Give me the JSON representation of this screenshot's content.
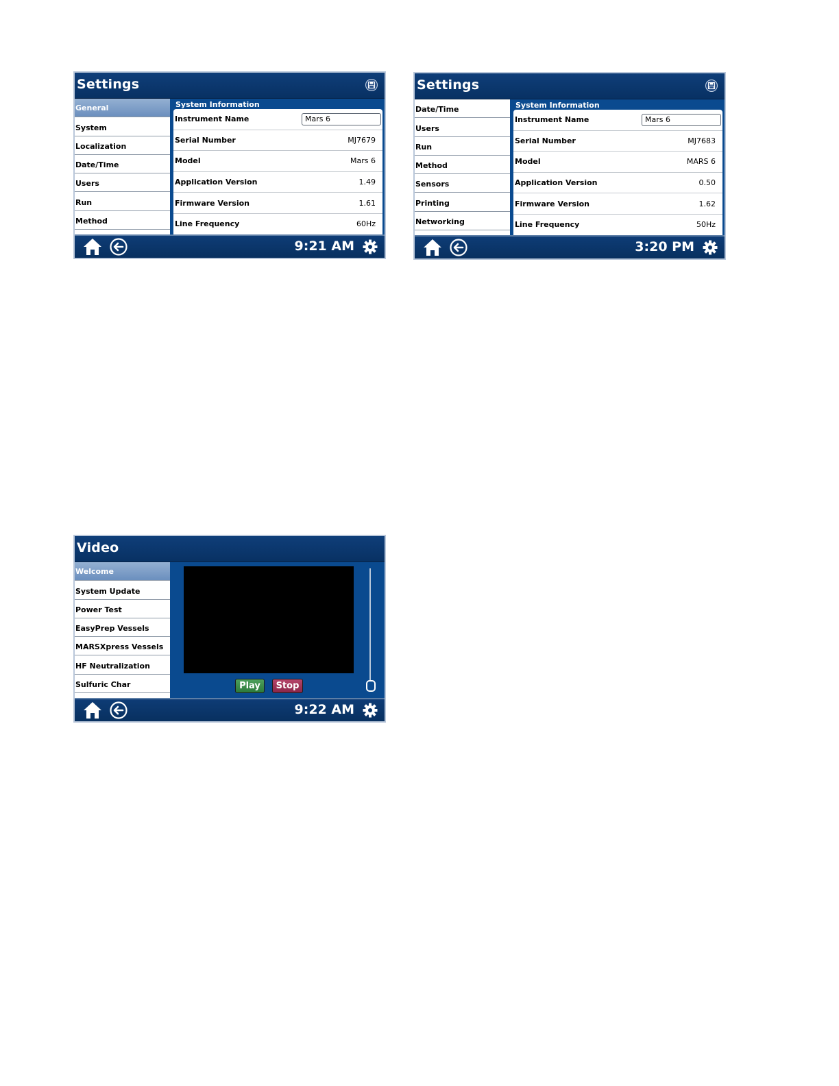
{
  "screens": [
    {
      "title": "Settings",
      "time": "9:21 AM",
      "sidebar": [
        {
          "label": "General",
          "selected": true
        },
        {
          "label": "System",
          "selected": false
        },
        {
          "label": "Localization",
          "selected": false
        },
        {
          "label": "Date/Time",
          "selected": false
        },
        {
          "label": "Users",
          "selected": false
        },
        {
          "label": "Run",
          "selected": false
        },
        {
          "label": "Method",
          "selected": false
        }
      ],
      "section": "System Information",
      "rows": [
        {
          "label": "Instrument Name",
          "value": "Mars 6",
          "editable": true
        },
        {
          "label": "Serial Number",
          "value": "MJ7679"
        },
        {
          "label": "Model",
          "value": "Mars 6"
        },
        {
          "label": "Application Version",
          "value": "1.49"
        },
        {
          "label": "Firmware Version",
          "value": "1.61"
        },
        {
          "label": "Line Frequency",
          "value": "60Hz"
        }
      ]
    },
    {
      "title": "Settings",
      "time": "3:20 PM",
      "sidebar": [
        {
          "label": "Date/Time",
          "selected": false
        },
        {
          "label": "Users",
          "selected": false
        },
        {
          "label": "Run",
          "selected": false
        },
        {
          "label": "Method",
          "selected": false
        },
        {
          "label": "Sensors",
          "selected": false
        },
        {
          "label": "Printing",
          "selected": false
        },
        {
          "label": "Networking",
          "selected": false
        }
      ],
      "section": "System Information",
      "rows": [
        {
          "label": "Instrument Name",
          "value": "Mars 6",
          "editable": true
        },
        {
          "label": "Serial Number",
          "value": "MJ7683"
        },
        {
          "label": "Model",
          "value": "MARS 6"
        },
        {
          "label": "Application Version",
          "value": "0.50"
        },
        {
          "label": "Firmware Version",
          "value": "1.62"
        },
        {
          "label": "Line Frequency",
          "value": "50Hz"
        }
      ]
    },
    {
      "title": "Video",
      "time": "9:22 AM",
      "sidebar": [
        {
          "label": "Welcome",
          "selected": true
        },
        {
          "label": "System Update",
          "selected": false
        },
        {
          "label": "Power Test",
          "selected": false
        },
        {
          "label": "EasyPrep Vessels",
          "selected": false
        },
        {
          "label": "MARSXpress Vessels",
          "selected": false
        },
        {
          "label": "HF Neutralization",
          "selected": false
        },
        {
          "label": "Sulfuric Char",
          "selected": false
        }
      ],
      "play_label": "Play",
      "stop_label": "Stop"
    }
  ],
  "icons": {
    "home": "home-icon",
    "back": "back-arrow-icon",
    "settings": "gear-icon",
    "save": "save-icon"
  },
  "colors": {
    "titlebar": "#0f3e79",
    "panel": "#0a4a8f",
    "selected_item": "#7f9fc8",
    "play_button": "#3a8c49",
    "stop_button": "#9e325a"
  }
}
